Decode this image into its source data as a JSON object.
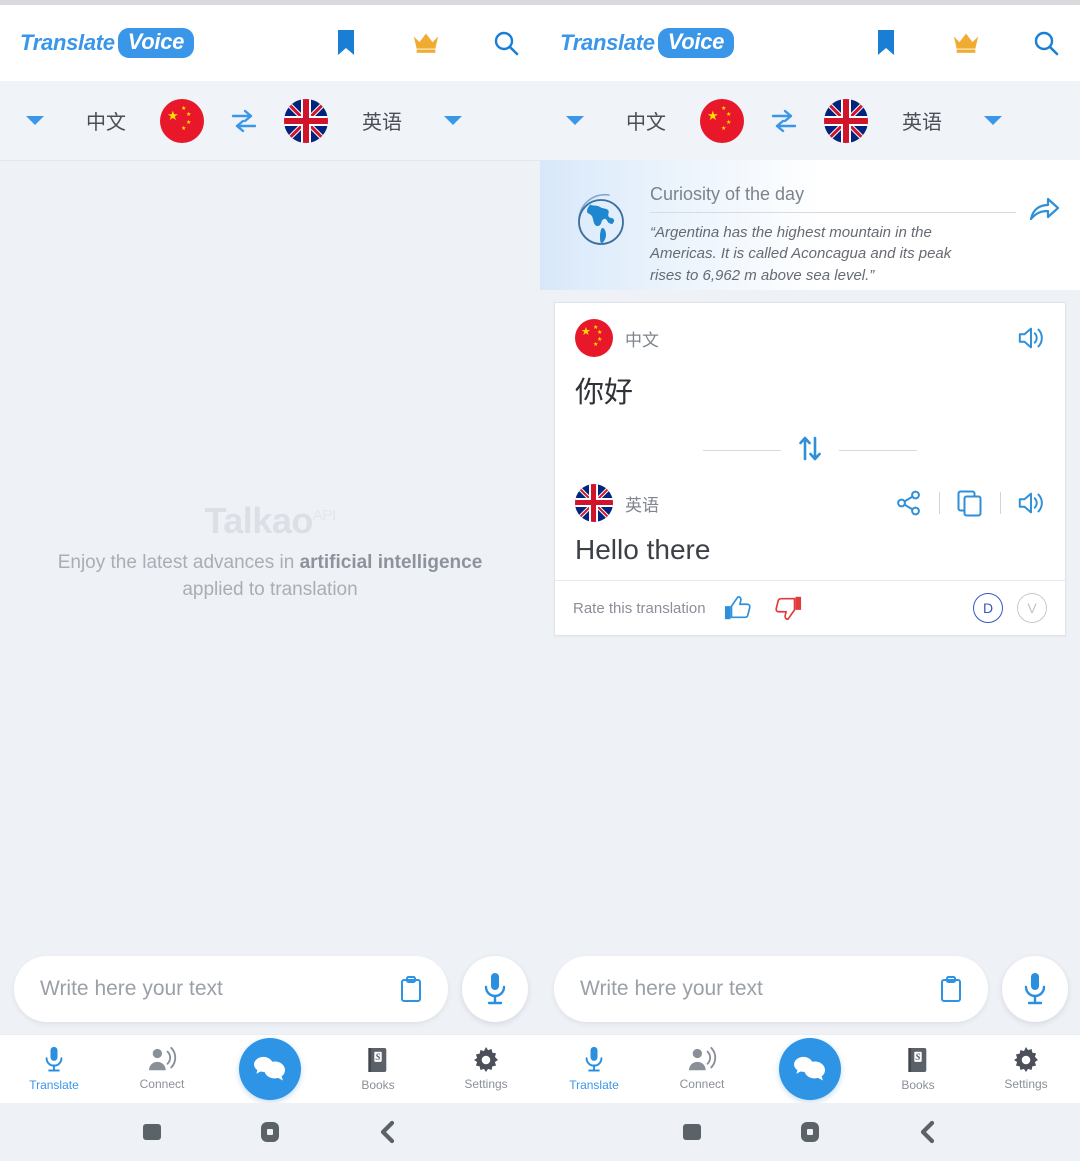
{
  "app": {
    "logo_translate": "Translate",
    "logo_voice": "Voice",
    "header_icons": [
      "bookmark-icon",
      "crown-icon",
      "search-icon"
    ]
  },
  "language_bar": {
    "source_language": "中文",
    "source_flag": "flag-china",
    "target_language": "英语",
    "target_flag": "flag-united-kingdom",
    "swap_icon": "swap-horizontal-icon",
    "left_caret": "chevron-down-icon",
    "right_caret": "chevron-down-icon"
  },
  "empty_state": {
    "brand": "Talkao",
    "brand_sup": "API",
    "line1_prefix": "Enjoy the latest advances in ",
    "line1_bold": "artificial intelligence",
    "line2": "applied to translation"
  },
  "curiosity": {
    "icon": "globe-icon",
    "title": "Curiosity of the day",
    "text": "“Argentina has the highest mountain in the Americas. It is called Aconcagua and its peak rises to 6,962 m above sea level.”",
    "share_icon": "share-arrow-icon"
  },
  "translation": {
    "source": {
      "flag": "flag-china",
      "language": "中文",
      "text": "你好",
      "actions": [
        "speaker-icon"
      ]
    },
    "swap_icon": "swap-vertical-icon",
    "target": {
      "flag": "flag-united-kingdom",
      "language": "英语",
      "text": "Hello there",
      "actions": [
        "share-icon",
        "copy-icon",
        "speaker-icon"
      ]
    },
    "rate": {
      "label": "Rate this translation",
      "thumbs_up_icon": "thumbs-up-icon",
      "thumbs_down_icon": "thumbs-down-icon",
      "badge_dictionary": "D",
      "badge_verbs": "V"
    }
  },
  "input": {
    "placeholder": "Write here your text",
    "clipboard_icon": "clipboard-icon",
    "mic_icon": "microphone-icon"
  },
  "bottom_nav": {
    "items": [
      {
        "label": "Translate",
        "icon": "microphone-icon",
        "active": true
      },
      {
        "label": "Connect",
        "icon": "person-speaking-icon",
        "active": false
      },
      {
        "label": "",
        "icon": "chat-bubbles-icon",
        "active": false
      },
      {
        "label": "Books",
        "icon": "book-icon",
        "active": false
      },
      {
        "label": "Settings",
        "icon": "gear-icon",
        "active": false
      }
    ]
  },
  "system_nav": {
    "recents_icon": "recents-square-icon",
    "home_icon": "home-icon",
    "back_icon": "back-chevron-icon"
  },
  "colors": {
    "accent_blue": "#2e95e6",
    "logo_blue": "#3a96e8",
    "background": "#eef1f6",
    "crown_gold": "#f0ab31",
    "flag_red": "#e8182a",
    "thumbs_down_red": "#e23b3b",
    "badge_blue": "#3558c8"
  }
}
